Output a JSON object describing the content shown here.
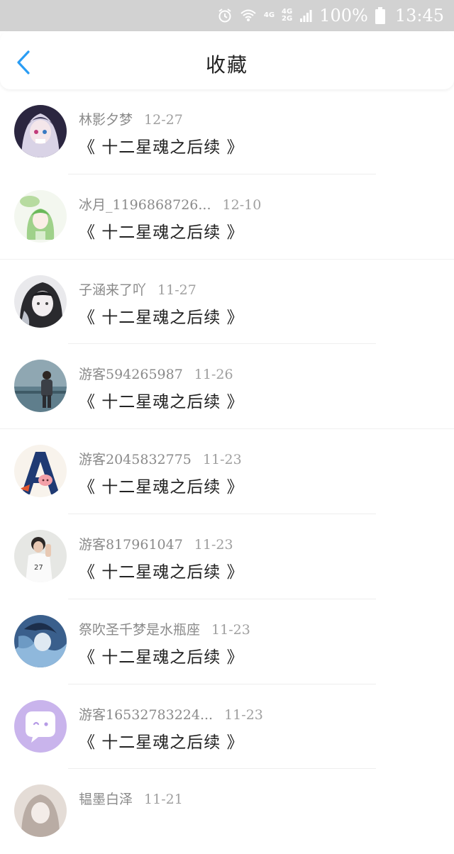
{
  "status_bar": {
    "net_top": "4G",
    "net_mid_top": "4G",
    "net_mid_bottom": "2G",
    "battery": "100%",
    "time": "13:45"
  },
  "header": {
    "title": "收藏"
  },
  "colors": {
    "accent": "#2a9df4",
    "status_bar_bg": "#d2d2d2",
    "title_text": "#222222",
    "meta_text": "#8a8a8a"
  },
  "items": [
    {
      "author": "林影夕梦",
      "date": "12-27",
      "title": "《 十二星魂之后续 》",
      "avatar": "anime-girl-dark"
    },
    {
      "author": "冰月_1196868726...",
      "date": "12-10",
      "title": "《 十二星魂之后续 》",
      "avatar": "anime-girl-green"
    },
    {
      "author": "子涵来了吖",
      "date": "11-27",
      "title": "《 十二星魂之后续 》",
      "avatar": "anime-girl-bw"
    },
    {
      "author": "游客594265987",
      "date": "11-26",
      "title": "《 十二星魂之后续 》",
      "avatar": "person-seaside"
    },
    {
      "author": "游客2045832775",
      "date": "11-23",
      "title": "《 十二星魂之后续 》",
      "avatar": "letter-a-pig"
    },
    {
      "author": "游客817961047",
      "date": "11-23",
      "title": "《 十二星魂之后续 》",
      "avatar": "boy-white-shirt"
    },
    {
      "author": "祭吹圣千梦是水瓶座",
      "date": "11-23",
      "title": "《 十二星魂之后续 》",
      "avatar": "anime-blue"
    },
    {
      "author": "游客16532783224...",
      "date": "11-23",
      "title": "《 十二星魂之后续 》",
      "avatar": "chat-bubble-purple"
    },
    {
      "author": "韫墨白泽",
      "date": "11-21",
      "title": "",
      "avatar": "anime-partial"
    }
  ]
}
